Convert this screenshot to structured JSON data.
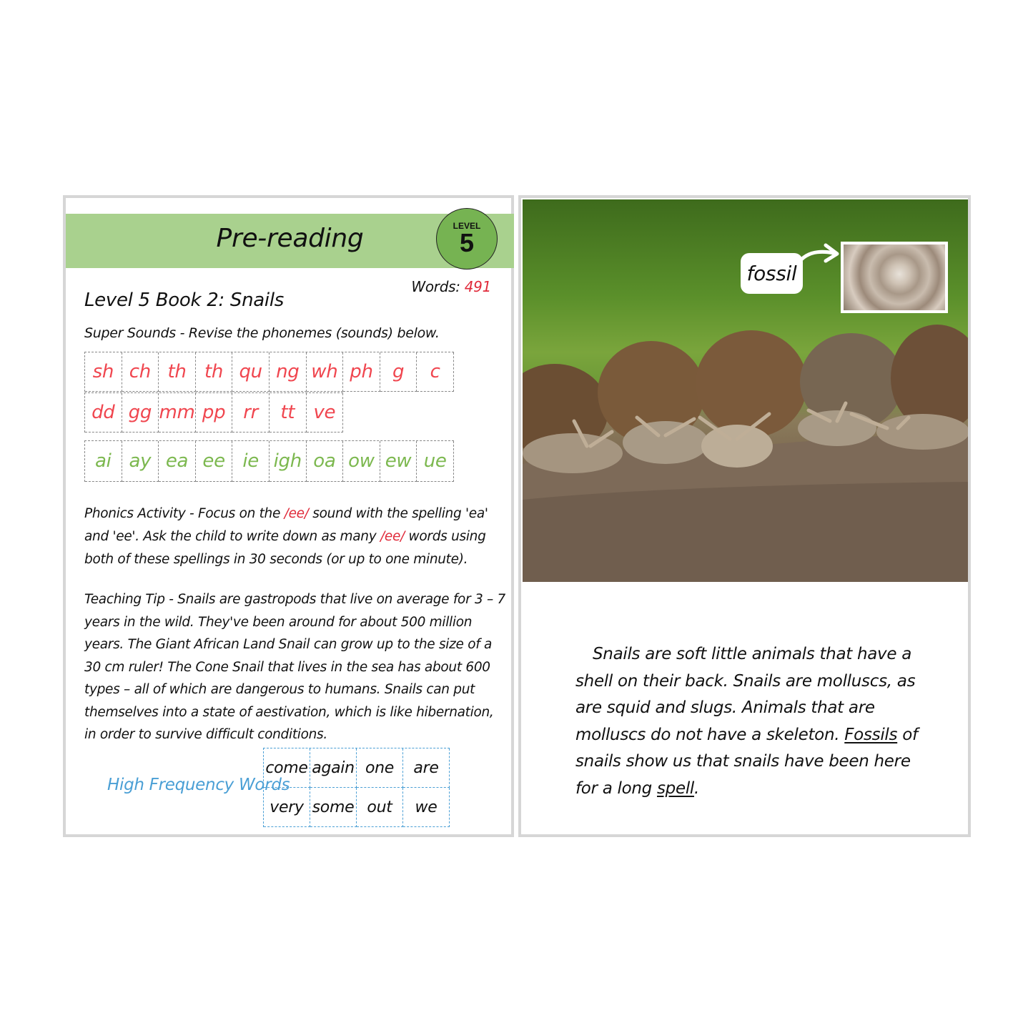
{
  "left_page": {
    "banner_title": "Pre-reading",
    "level_badge": {
      "label": "LEVEL",
      "number": "5"
    },
    "words_label": "Words:",
    "words_count": "491",
    "book_title": "Level 5 Book 2: Snails",
    "super_sounds_text": "Super Sounds - Revise the phonemes (sounds) below.",
    "sounds_row1": [
      "sh",
      "ch",
      "th",
      "th",
      "qu",
      "ng",
      "wh",
      "ph",
      "g",
      "c"
    ],
    "sounds_row2": [
      "dd",
      "gg",
      "mm",
      "pp",
      "rr",
      "tt",
      "ve"
    ],
    "sounds_row3": [
      "ai",
      "ay",
      "ea",
      "ee",
      "ie",
      "igh",
      "oa",
      "ow",
      "ew",
      "ue"
    ],
    "phonics": {
      "part1": "Phonics Activity - Focus on the ",
      "accent1": "/ee/",
      "part2": " sound with the spelling 'ea' and 'ee'. Ask the child to write down as many ",
      "accent2": "/ee/",
      "part3": " words using both of these spellings in 30 seconds (or up to one minute)."
    },
    "teaching_tip": "Teaching Tip - Snails are gastropods that live on average for 3 – 7 years in the wild. They've been around for about 500 million years. The Giant African Land Snail can grow up to the size of a 30 cm ruler! The Cone Snail that lives in the sea has about 600 types – all of which are dangerous to humans. Snails can put themselves into a state of aestivation, which is like hibernation, in order to survive difficult conditions.",
    "hfw_label": "High Frequency Words",
    "hfw_words": [
      "come",
      "again",
      "one",
      "are",
      "very",
      "some",
      "out",
      "we"
    ]
  },
  "right_page": {
    "photo_description": "snails-on-rock-photo",
    "fossil_label": "fossil",
    "story": {
      "part1": "Snails are soft little animals that have a shell on their back. Snails are molluscs, as are squid and slugs. Animals that are molluscs do not have a skeleton. ",
      "underlined1": "Fossils",
      "part2": " of snails show us that snails have been here for a long ",
      "underlined2": "spell",
      "part3": "."
    }
  },
  "colors": {
    "banner": "#a9d18e",
    "badge": "#76b352",
    "consonant_red": "#f0464f",
    "vowel_green": "#7cb84f",
    "accent_red": "#e02a3a",
    "hfw_blue": "#4a9fd5",
    "page_border": "#d6d6d6"
  }
}
